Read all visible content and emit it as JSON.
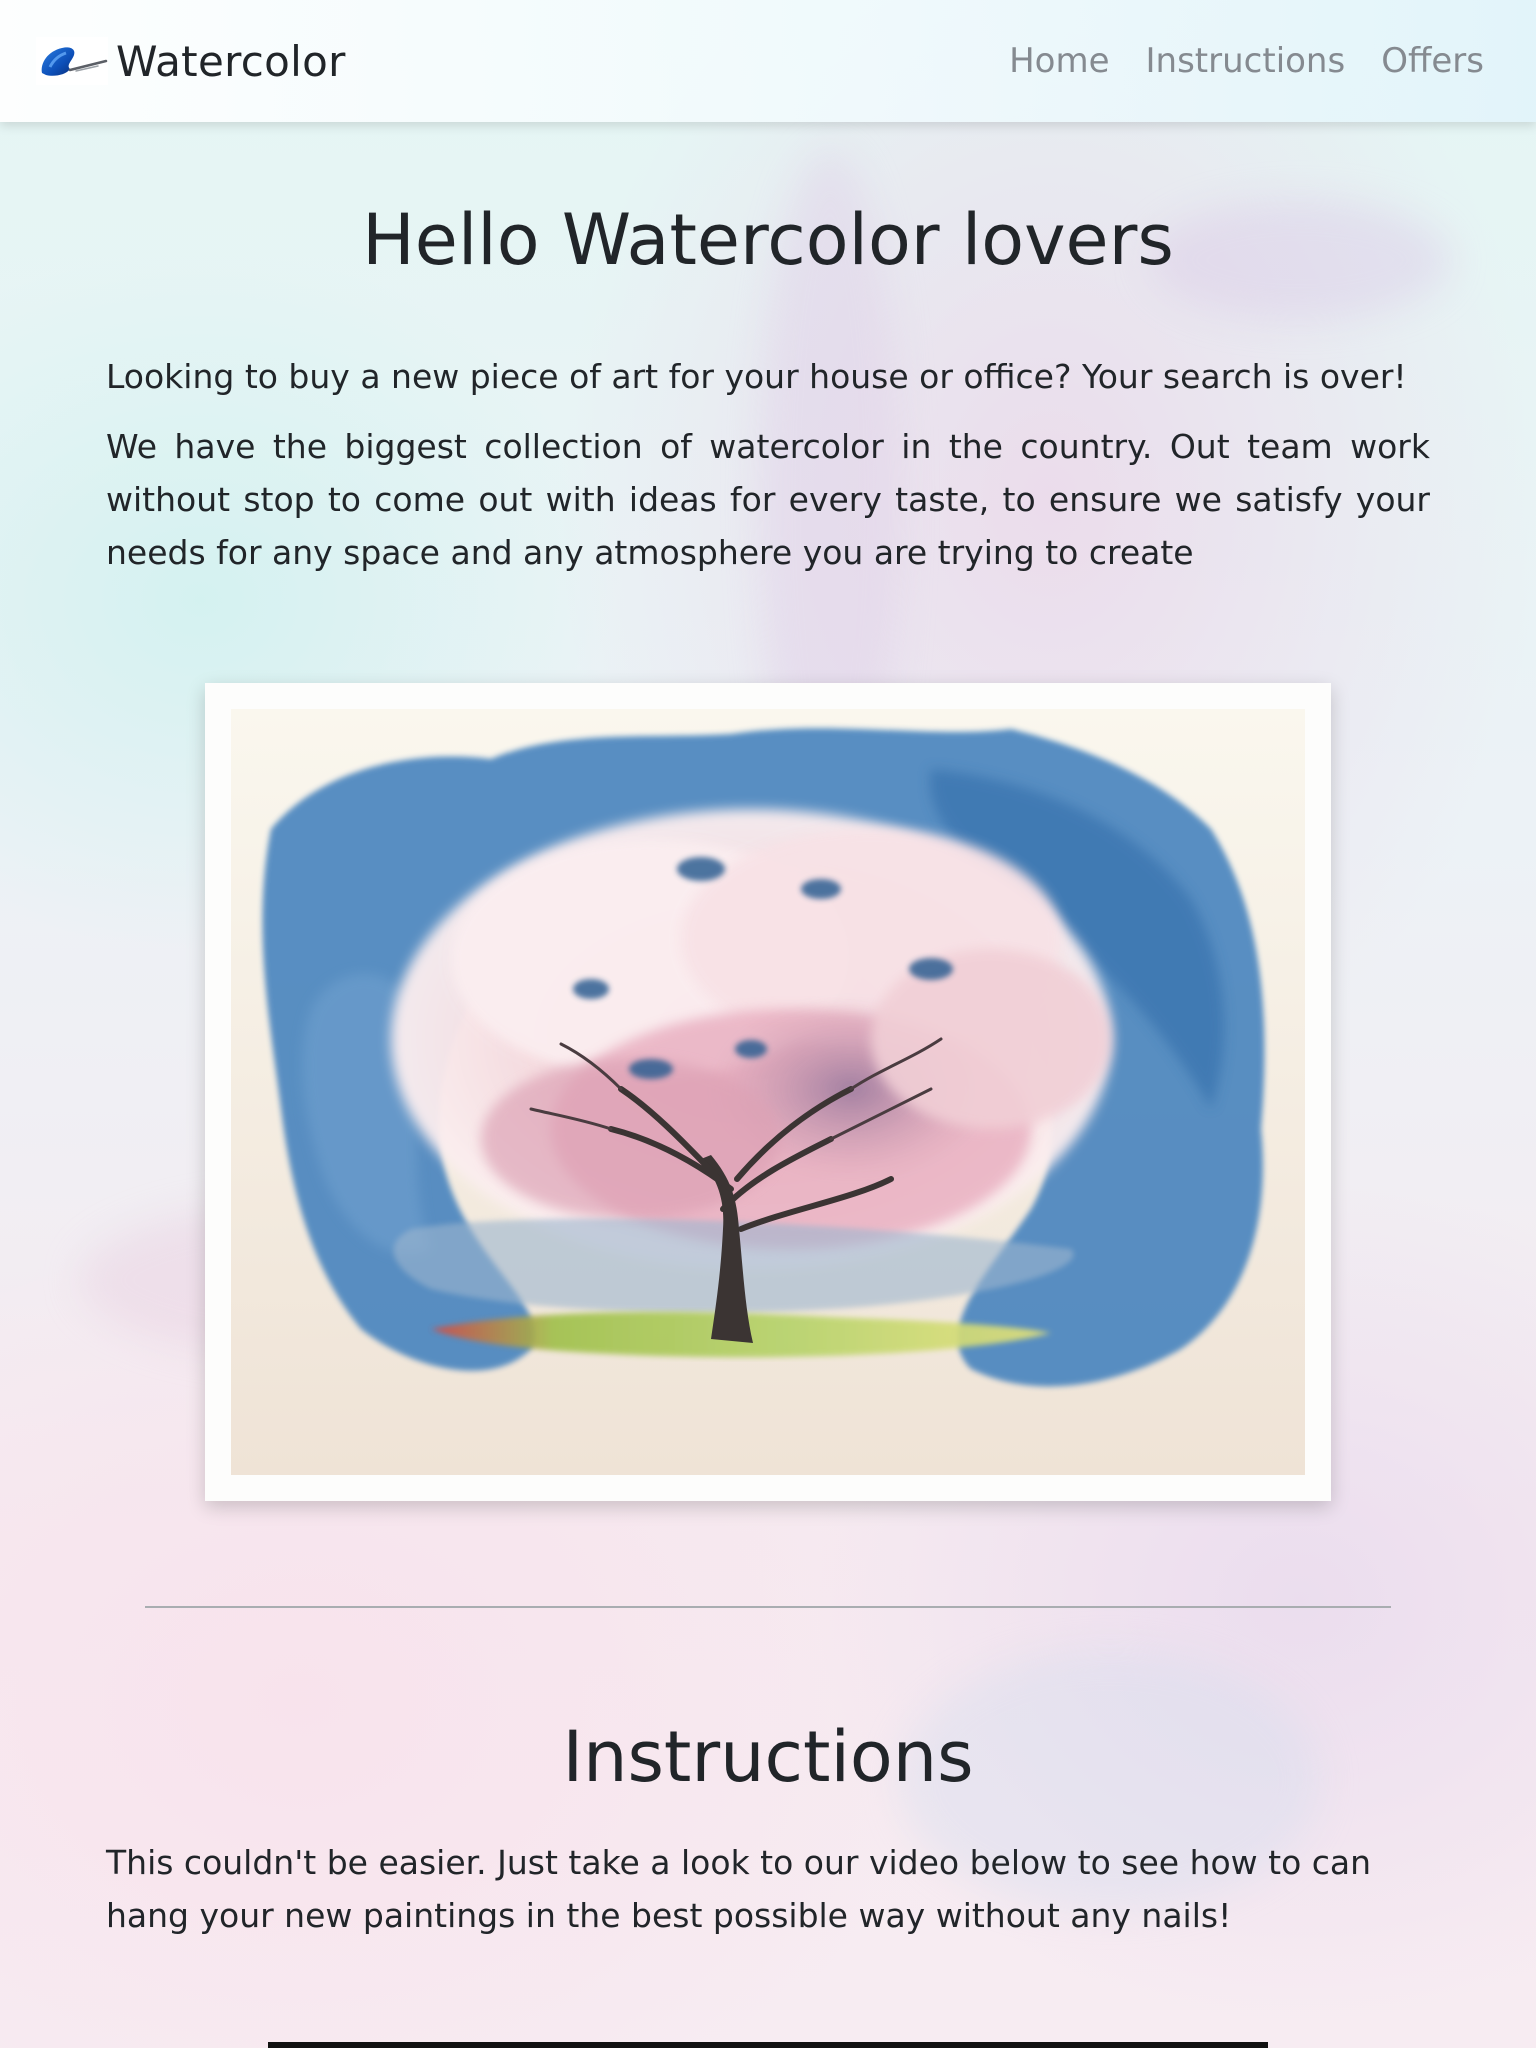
{
  "navbar": {
    "brand": "Watercolor",
    "links": [
      "Home",
      "Instructions",
      "Offers"
    ],
    "logo_icon": "paint-brush-stroke-icon"
  },
  "hero": {
    "title": "Hello Watercolor lovers",
    "paragraph_1": "Looking to buy a new piece of art for your house or office? Your search is over!",
    "paragraph_2": "We have the biggest collection of watercolor in the country. Out team work without stop to come out with ideas for every taste, to ensure we satisfy your needs for any space and any atmosphere you are trying to create"
  },
  "gallery": {
    "image_subject": "watercolor cherry blossom tree painting"
  },
  "instructions": {
    "title": "Instructions",
    "paragraph": "This couldn't be easier. Just take a look to our video below to see how to can hang your new paintings in the best possible way without any nails!"
  },
  "colors": {
    "text": "#212529",
    "nav_link": "#858a90",
    "divider": "#a9adb1"
  }
}
